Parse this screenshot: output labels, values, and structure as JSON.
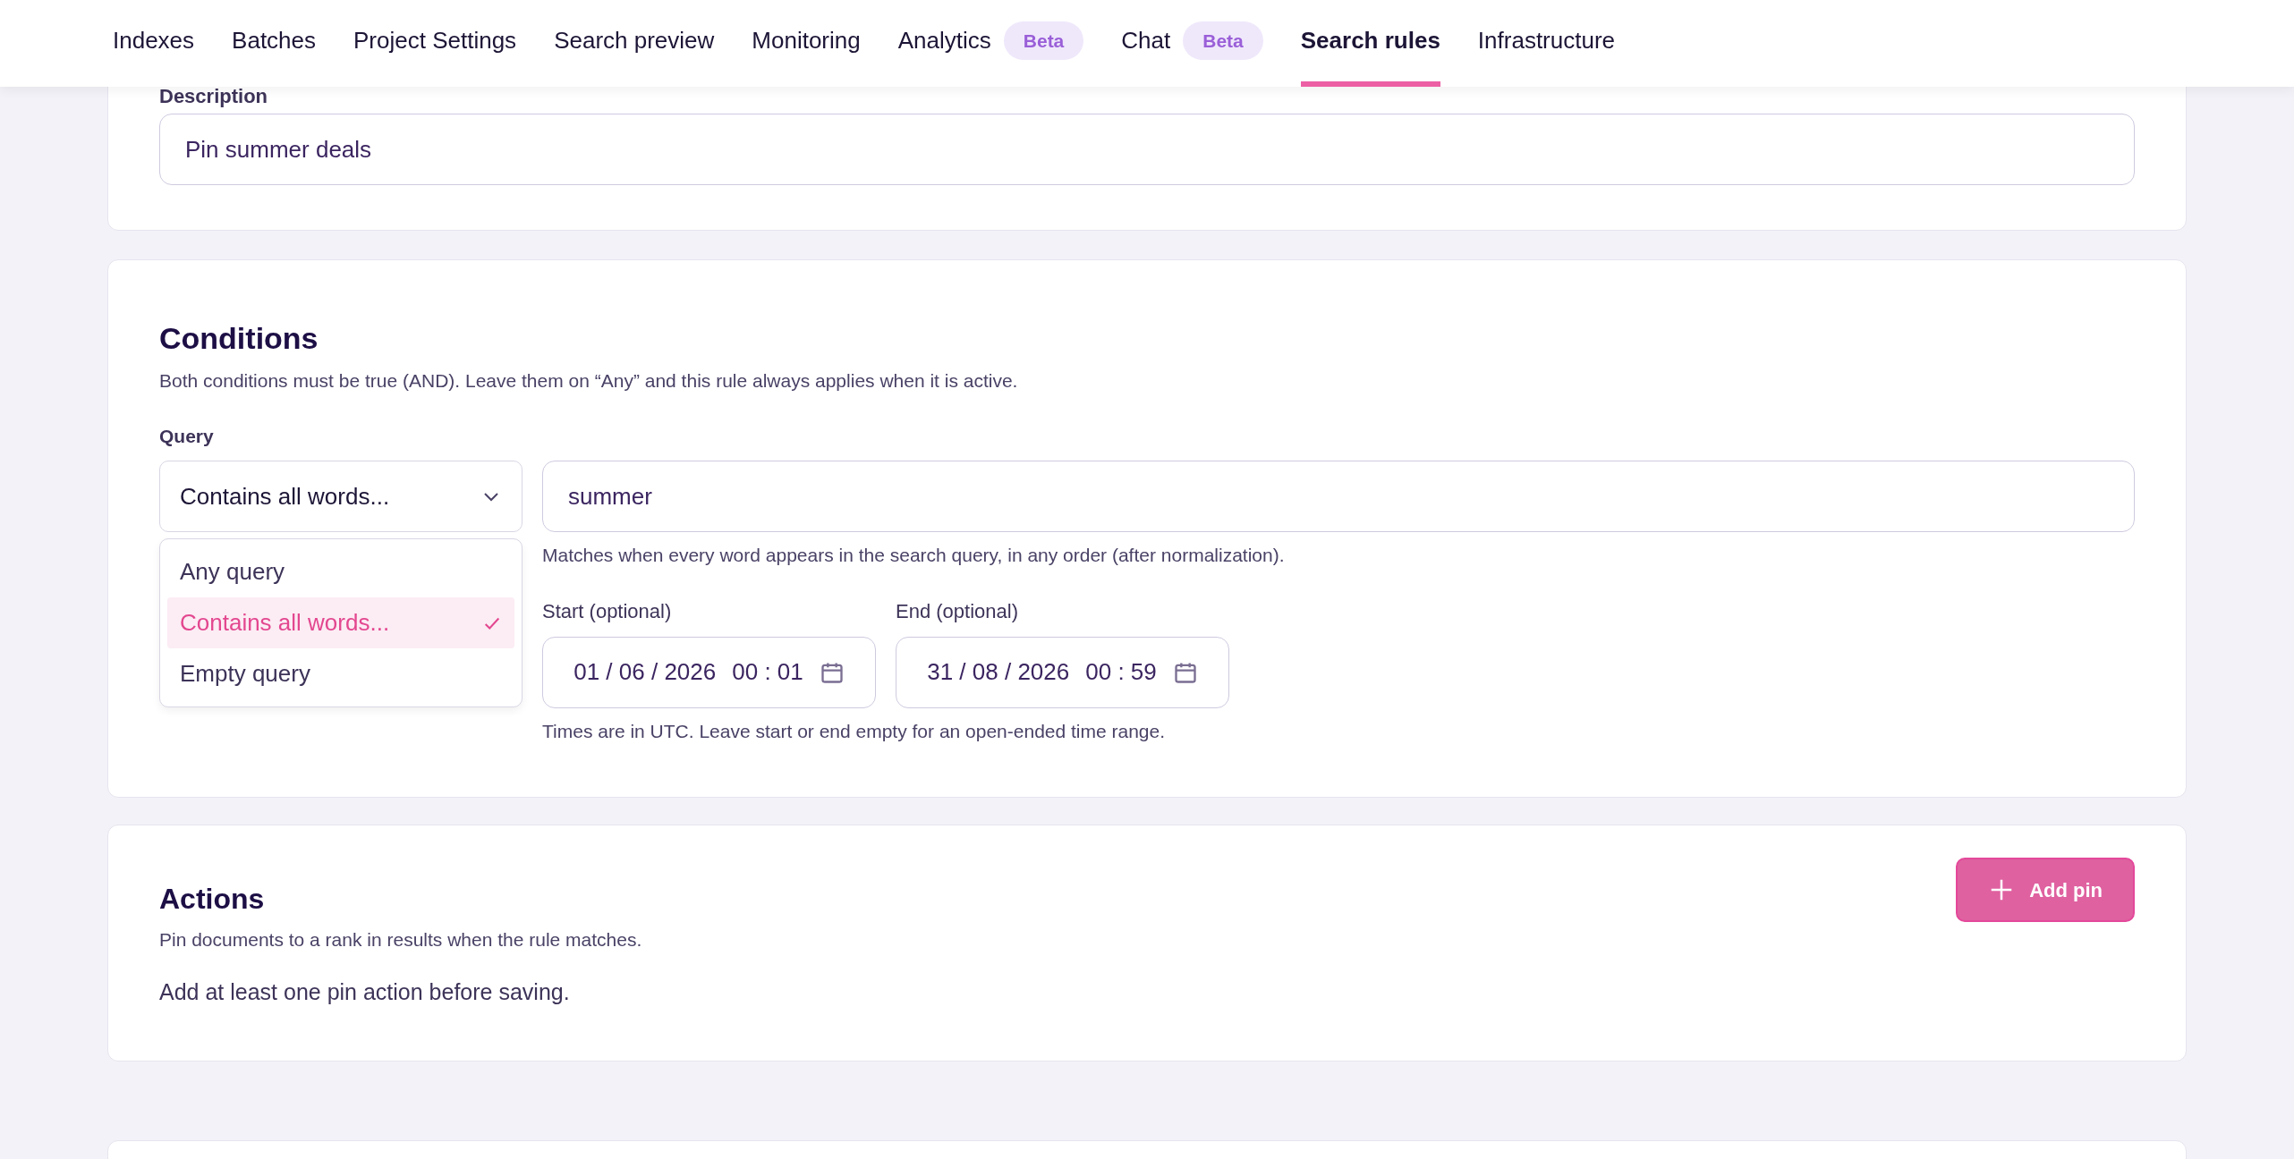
{
  "nav": {
    "tabs": [
      {
        "label": "Indexes",
        "selected": false
      },
      {
        "label": "Batches",
        "selected": false
      },
      {
        "label": "Project Settings",
        "selected": false
      },
      {
        "label": "Search preview",
        "selected": false
      },
      {
        "label": "Monitoring",
        "selected": false
      },
      {
        "label": "Analytics",
        "badge": "Beta",
        "selected": false
      },
      {
        "label": "Chat",
        "badge": "Beta",
        "selected": false
      },
      {
        "label": "Search rules",
        "selected": true
      },
      {
        "label": "Infrastructure",
        "selected": false
      }
    ]
  },
  "description": {
    "label": "Description",
    "value": "Pin summer deals"
  },
  "conditions": {
    "title": "Conditions",
    "subtitle": "Both conditions must be true (AND). Leave them on “Any” and this rule always applies when it is active.",
    "query_label": "Query",
    "select_value": "Contains all words...",
    "options": [
      {
        "label": "Any query",
        "selected": false
      },
      {
        "label": "Contains all words...",
        "selected": true
      },
      {
        "label": "Empty query",
        "selected": false
      }
    ],
    "query_value": "summer",
    "query_hint": "Matches when every word appears in the search query, in any order (after normalization).",
    "start": {
      "label": "Start (optional)",
      "date": "01 / 06 / 2026",
      "time": "00 : 01"
    },
    "end": {
      "label": "End (optional)",
      "date": "31 / 08 / 2026",
      "time": "00 : 59"
    },
    "time_hint": "Times are in UTC. Leave start or end empty for an open-ended time range."
  },
  "actions": {
    "title": "Actions",
    "subtitle": "Pin documents to a rank in results when the rule matches.",
    "add_button": "Add pin",
    "empty_note": "Add at least one pin action before saving."
  }
}
